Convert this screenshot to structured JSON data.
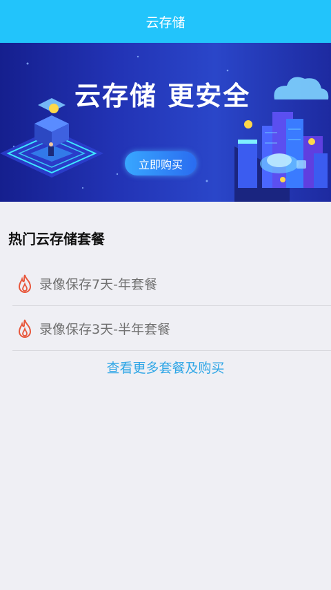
{
  "header": {
    "title": "云存储"
  },
  "banner": {
    "headline": "云存储 更安全",
    "button_label": "立即购买"
  },
  "section": {
    "title": "热门云存储套餐"
  },
  "plans": [
    {
      "label": "录像保存7天-年套餐",
      "icon": "fire-icon"
    },
    {
      "label": "录像保存3天-半年套餐",
      "icon": "fire-icon"
    }
  ],
  "more_link": "查看更多套餐及购买",
  "colors": {
    "header_bg": "#22c4fb",
    "link": "#2fa6e6",
    "fire": "#e8573c",
    "page_bg": "#efeff4"
  }
}
